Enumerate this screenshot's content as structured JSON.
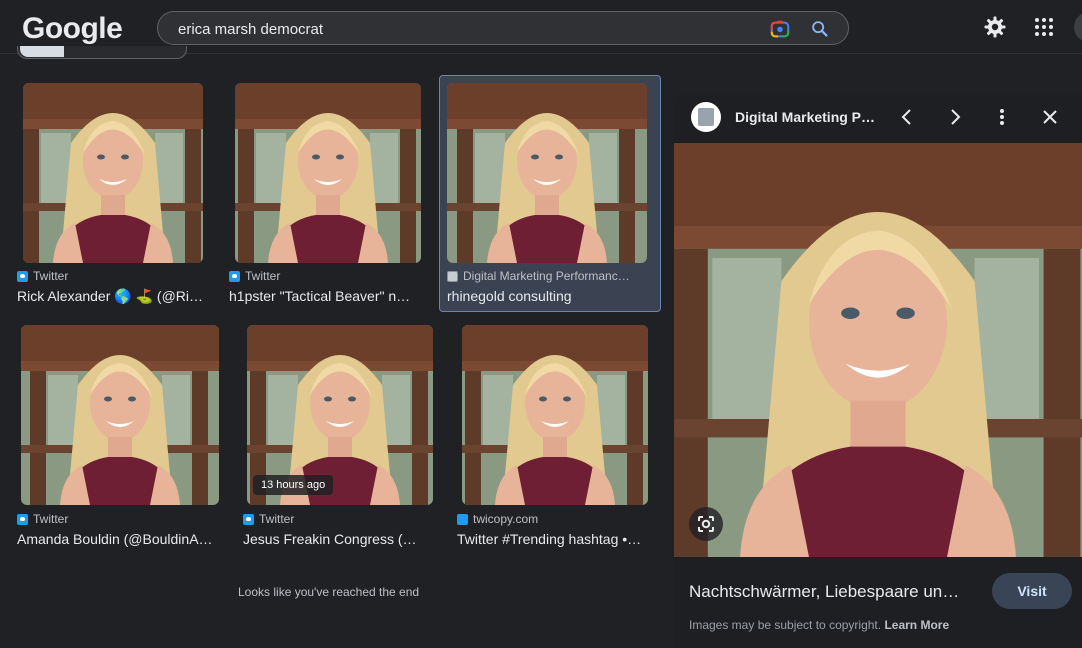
{
  "header": {
    "logo": "Google",
    "search_value": "erica marsh democrat"
  },
  "results": [
    {
      "source": "Twitter",
      "source_icon": "twitter-icon",
      "title": "Rick Alexander 🌎 ⛳ (@Ri…",
      "badge": ""
    },
    {
      "source": "Twitter",
      "source_icon": "twitter-icon",
      "title": "h1pster \"Tactical Beaver\" n…",
      "badge": ""
    },
    {
      "source": "Digital Marketing Performanc…",
      "source_icon": "site-favicon-icon",
      "title": "rhinegold consulting",
      "badge": ""
    },
    {
      "source": "Twitter",
      "source_icon": "twitter-icon",
      "title": "Amanda Bouldin (@BouldinA…",
      "badge": ""
    },
    {
      "source": "Twitter",
      "source_icon": "twitter-icon",
      "title": "Jesus Freakin Congress (…",
      "badge": "13 hours ago"
    },
    {
      "source": "twicopy.com",
      "source_icon": "twitter-icon",
      "title": "Twitter #Trending hashtag •…",
      "badge": ""
    }
  ],
  "end_message": "Looks like you've reached the end",
  "panel": {
    "source_name": "Digital Marketing P…",
    "title": "Nachtschwärmer, Liebespaare un…",
    "visit_label": "Visit",
    "copyright_text": "Images may be subject to copyright.",
    "learn_more_label": "Learn More"
  },
  "colors": {
    "background": "#202124",
    "selected_card": "#3b4252",
    "visit_button": "#394457",
    "twitter_blue": "#1d9bf0"
  }
}
